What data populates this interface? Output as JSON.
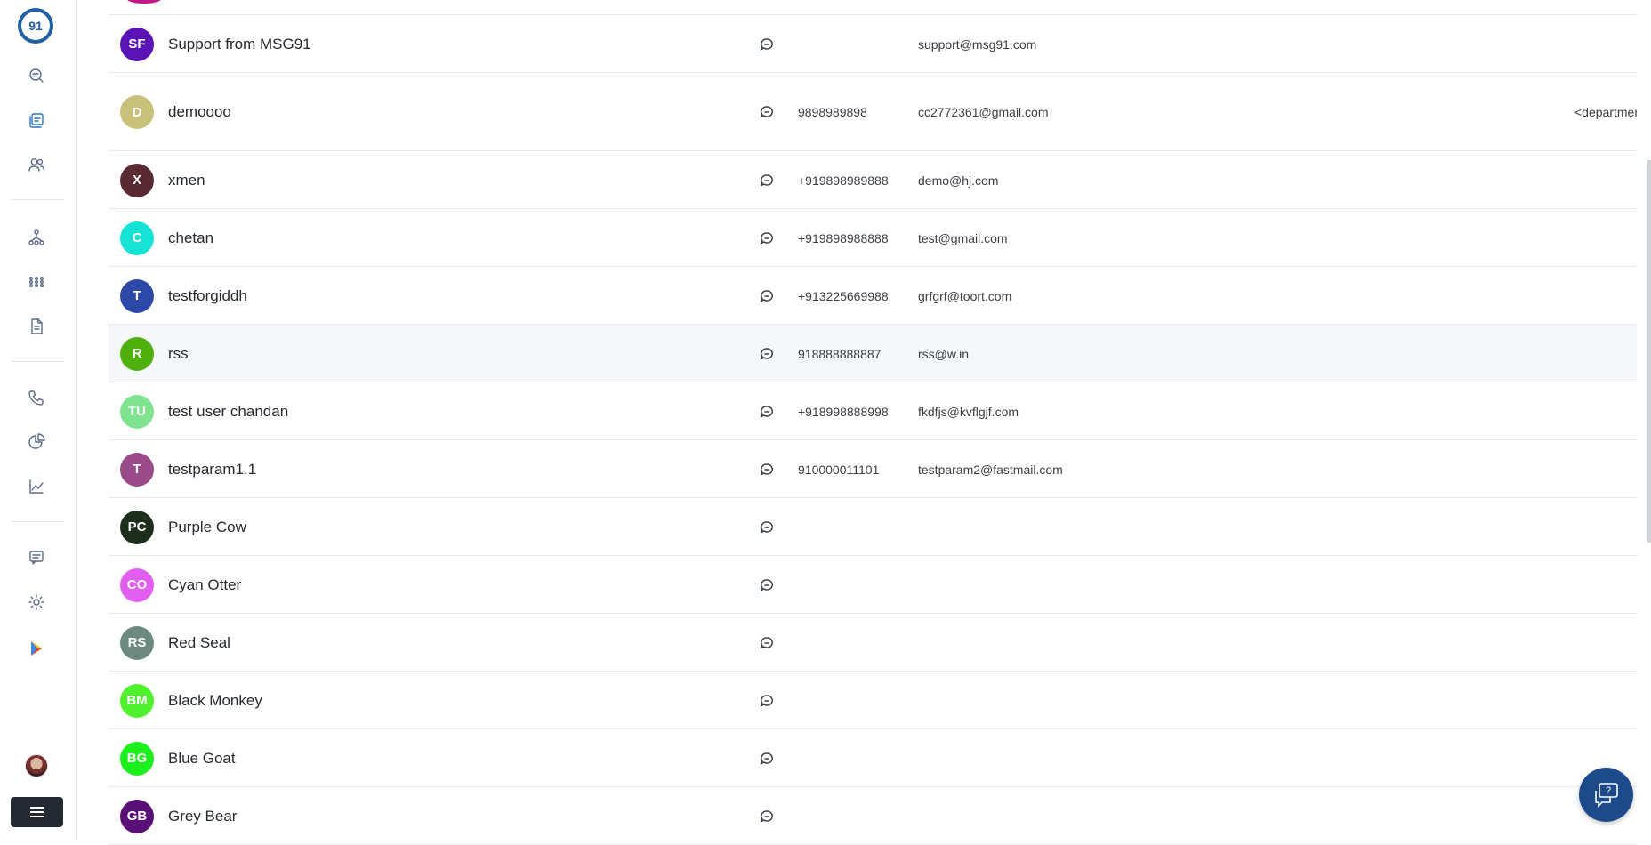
{
  "sidebar": {
    "logo_text": "91",
    "icons": [
      "chat-search-icon",
      "inbox-icon",
      "contacts-icon",
      "workflow-icon",
      "apps-grid-icon",
      "document-icon",
      "phone-icon",
      "pie-chart-icon",
      "line-chart-icon",
      "message-icon",
      "gear-icon",
      "play-store-icon"
    ]
  },
  "contacts": [
    {
      "initials": "SF",
      "name": "Support from MSG91",
      "phone": "",
      "email": "support@msg91.com",
      "extra": "",
      "color": "#5a13b7"
    },
    {
      "initials": "D",
      "name": "demoooo",
      "phone": "9898989898",
      "email": "cc2772361@gmail.com",
      "extra": "<departmen",
      "color": "#c9c07a"
    },
    {
      "initials": "X",
      "name": "xmen",
      "phone": "+919898989888",
      "email": "demo@hj.com",
      "extra": "",
      "color": "#5a2a33"
    },
    {
      "initials": "C",
      "name": "chetan",
      "phone": "+919898988888",
      "email": "test@gmail.com",
      "extra": "",
      "color": "#14e3d5"
    },
    {
      "initials": "T",
      "name": "testforgiddh",
      "phone": "+913225669988",
      "email": "grfgrf@toort.com",
      "extra": "",
      "color": "#2c49a8"
    },
    {
      "initials": "R",
      "name": "rss",
      "phone": "918888888887",
      "email": "rss@w.in",
      "extra": "",
      "color": "#4eb00d"
    },
    {
      "initials": "TU",
      "name": "test user chandan",
      "phone": "+918998888998",
      "email": "fkdfjs@kvflgjf.com",
      "extra": "",
      "color": "#7fe38f"
    },
    {
      "initials": "T",
      "name": "testparam1.1",
      "phone": "910000011101",
      "email": "testparam2@fastmail.com",
      "extra": "",
      "color": "#9b4a8a"
    },
    {
      "initials": "PC",
      "name": "Purple Cow",
      "phone": "",
      "email": "",
      "extra": "",
      "color": "#1d2e1c"
    },
    {
      "initials": "CO",
      "name": "Cyan Otter",
      "phone": "",
      "email": "",
      "extra": "",
      "color": "#e35ef0"
    },
    {
      "initials": "RS",
      "name": "Red Seal",
      "phone": "",
      "email": "",
      "extra": "",
      "color": "#6d8a80"
    },
    {
      "initials": "BM",
      "name": "Black Monkey",
      "phone": "",
      "email": "",
      "extra": "",
      "color": "#4ff02c"
    },
    {
      "initials": "BG",
      "name": "Blue Goat",
      "phone": "",
      "email": "",
      "extra": "",
      "color": "#1cf01c"
    },
    {
      "initials": "GB",
      "name": "Grey Bear",
      "phone": "",
      "email": "",
      "extra": "",
      "color": "#5a0f78"
    }
  ],
  "help": {
    "icon": "help-chat-icon"
  }
}
